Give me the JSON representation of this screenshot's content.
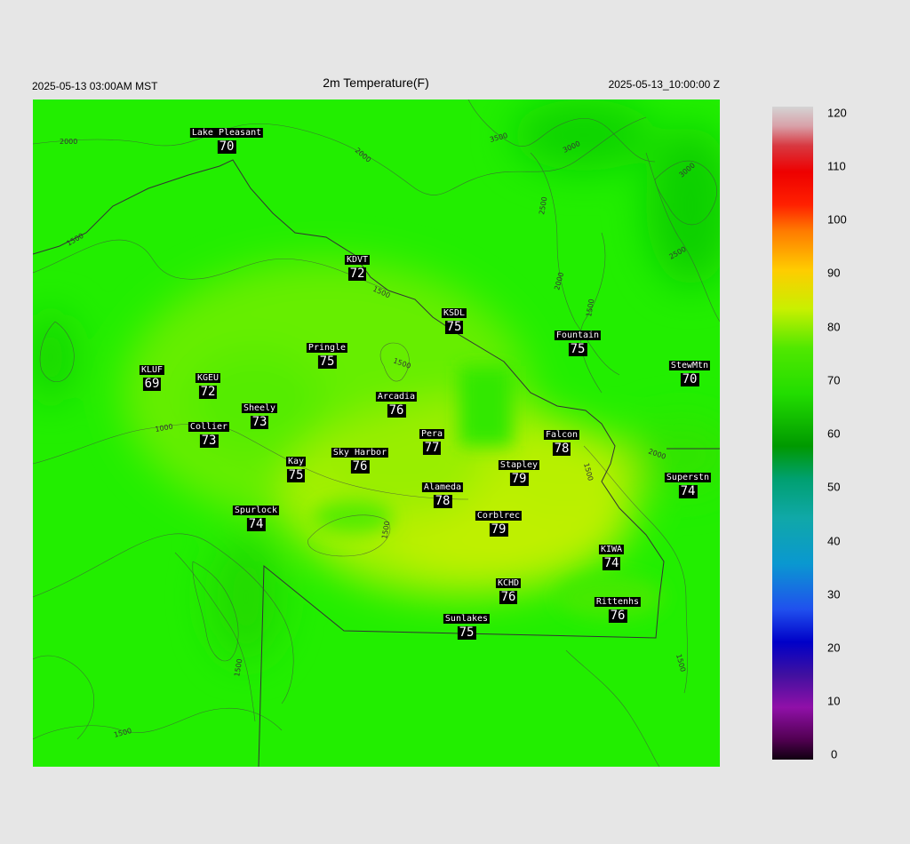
{
  "header": {
    "local_time": "2025-05-13 03:00AM MST",
    "title": "2m Temperature(F)",
    "utc_time": "2025-05-13_10:00:00 Z"
  },
  "colorbar": {
    "min": 0,
    "max": 120,
    "ticks": [
      "120",
      "110",
      "100",
      "90",
      "80",
      "70",
      "60",
      "50",
      "40",
      "30",
      "20",
      "10",
      "0"
    ]
  },
  "contour_labels": [
    "2000",
    "2000",
    "3500",
    "3000",
    "2500",
    "3000",
    "2500",
    "2000",
    "1500",
    "1500",
    "1500",
    "1500",
    "1000",
    "2000",
    "1500",
    "1500",
    "1500",
    "1500",
    "1500"
  ],
  "stations": [
    {
      "name": "Lake Pleasant",
      "temp": "70"
    },
    {
      "name": "KDVT",
      "temp": "72"
    },
    {
      "name": "KSDL",
      "temp": "75"
    },
    {
      "name": "Fountain",
      "temp": "75"
    },
    {
      "name": "Pringle",
      "temp": "75"
    },
    {
      "name": "StewMtn",
      "temp": "70"
    },
    {
      "name": "KLUF",
      "temp": "69"
    },
    {
      "name": "KGEU",
      "temp": "72"
    },
    {
      "name": "Arcadia",
      "temp": "76"
    },
    {
      "name": "Sheely",
      "temp": "73"
    },
    {
      "name": "Collier",
      "temp": "73"
    },
    {
      "name": "Pera",
      "temp": "77"
    },
    {
      "name": "Falcon",
      "temp": "78"
    },
    {
      "name": "Kay",
      "temp": "75"
    },
    {
      "name": "Sky Harbor",
      "temp": "76"
    },
    {
      "name": "Stapley",
      "temp": "79"
    },
    {
      "name": "Superstn",
      "temp": "74"
    },
    {
      "name": "Alameda",
      "temp": "78"
    },
    {
      "name": "Spurlock",
      "temp": "74"
    },
    {
      "name": "Corblrec",
      "temp": "79"
    },
    {
      "name": "KIWA",
      "temp": "74"
    },
    {
      "name": "KCHD",
      "temp": "76"
    },
    {
      "name": "Rittenhs",
      "temp": "76"
    },
    {
      "name": "Sunlakes",
      "temp": "75"
    }
  ]
}
